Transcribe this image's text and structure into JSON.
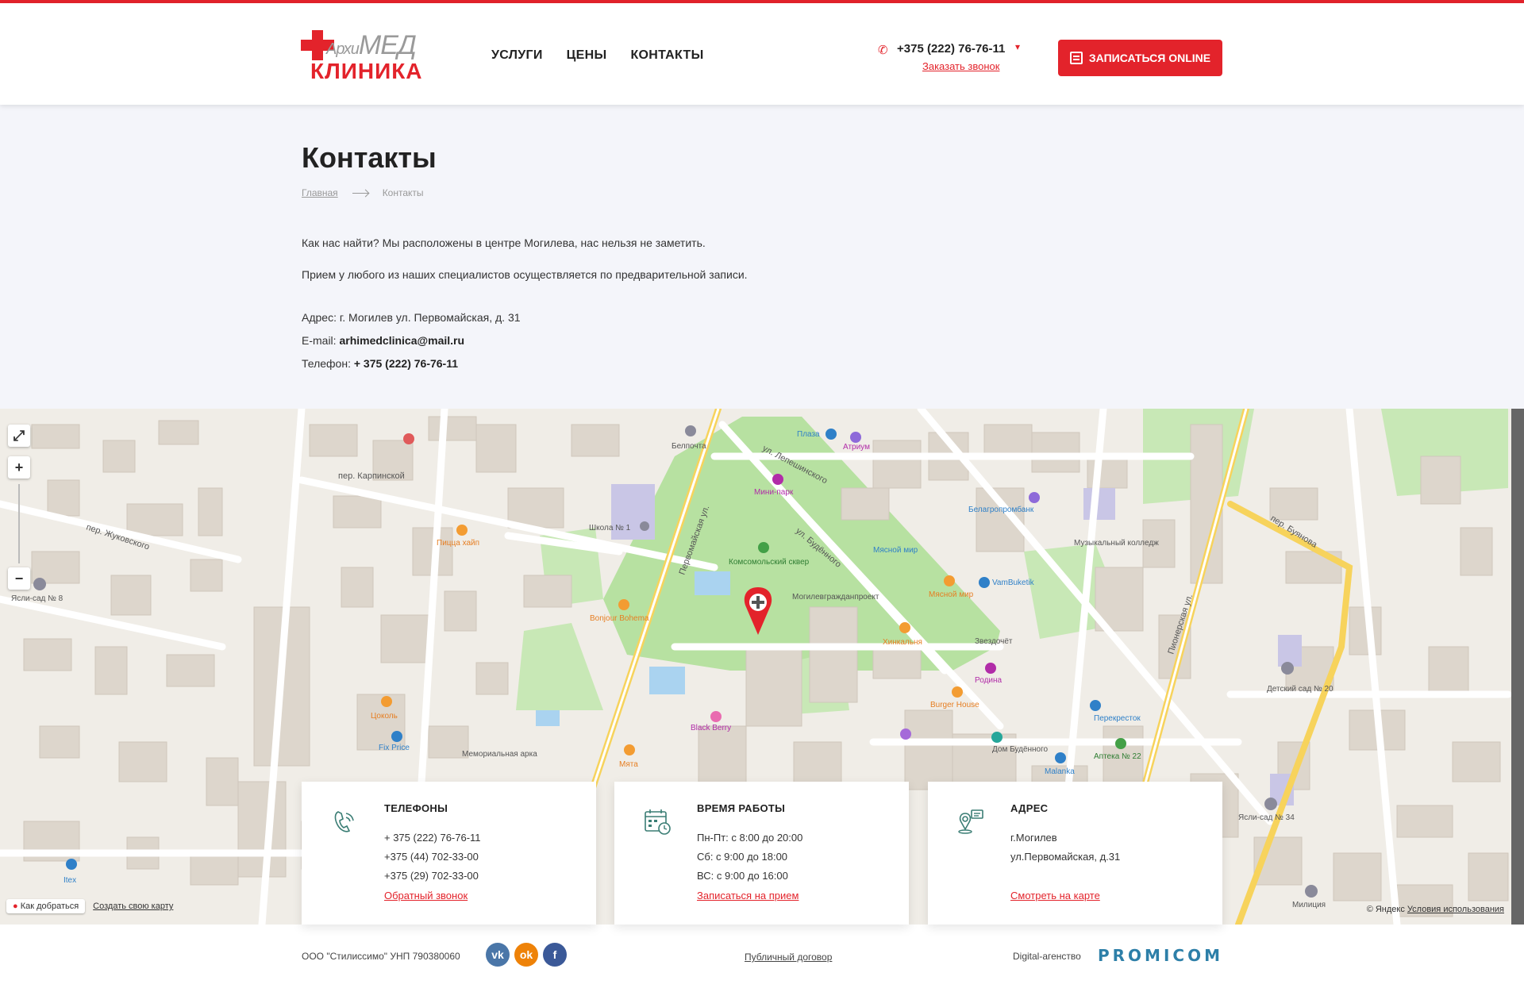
{
  "brand": {
    "logo_top_small": "Архи",
    "logo_top": "МЕД",
    "logo_bottom": "КЛИНИКА",
    "accent": "#e3232b"
  },
  "nav": {
    "items": [
      "УСЛУГИ",
      "ЦЕНЫ",
      "КОНТАКТЫ"
    ]
  },
  "header": {
    "phone": "+375 (222) 76-76-11",
    "callback": "Заказать звонок",
    "cta": "ЗАПИСАТЬСЯ ONLINE",
    "phone_icon": "phone-icon",
    "cta_icon": "form-icon"
  },
  "page": {
    "title": "Контакты",
    "breadcrumb_home": "Главная",
    "breadcrumb_current": "Контакты",
    "intro1": "Как нас найти? Мы расположены в центре Могилева, нас нельзя не заметить.",
    "intro2": "Прием у любого из наших специалистов осуществляется по предварительной записи.",
    "address_label": "Адрес:",
    "address": "г. Могилев ул. Первомайская, д. 31",
    "email_label": "E-mail:",
    "email": "arhimedclinica@mail.ru",
    "phone_label": "Телефон:",
    "phone": "+ 375 (222) 76-76-11"
  },
  "map": {
    "route": "Как добраться",
    "create": "Создать свою карту",
    "attribution": "© Яндекс",
    "terms": "Условия использования",
    "zoom_in": "+",
    "zoom_out": "−",
    "fullscreen_icon": "expand-icon",
    "labels": {
      "pervomayskaya": "Первомайская ул.",
      "pionerskaya": "Пионерская ул.",
      "lepeshinskogo": "ул. Лепешинского",
      "budennogo": "ул. Будённого",
      "karpinskoy": "пер. Карпинской",
      "zhukovskogo": "пер. Жуковского",
      "buyanova": "пер. Буянова",
      "komsomolsky": "Комсомольский сквер",
      "mini_park": "Мини-парк",
      "shkola": "Школа № 1",
      "plaza": "Плаза",
      "atrium": "Атриум",
      "myasnoy": "Мясной мир",
      "burger": "Burger House",
      "hinkalnya": "Хинкальня",
      "blackberry": "Black Berry",
      "bonjour": "Bonjour Bohema",
      "pizza": "Пицца хайп",
      "fixprice": "Fix Price",
      "tsokol": "Цоколь",
      "mogilev": "Могилевграждан­проект",
      "belagro": "Белагропромбанк",
      "muz": "Музыкальный колледж",
      "vambuketik": "VamBuketik",
      "zvezdochet": "Звездочёт",
      "rodina": "Родина",
      "perekrestok": "Перекресток",
      "apteka": "Аптека № 22",
      "malanka": "Malanka",
      "dom": "Дом Будённого",
      "memorial": "Мемориальная арка",
      "myata": "Мята",
      "yasli8": "Ясли-сад № 8",
      "detsad20": "Детский сад № 20",
      "yasli34": "Ясли-сад № 34",
      "militsiya": "Милиция",
      "itex": "Itex",
      "belpochta": "Белпочта"
    }
  },
  "cards": [
    {
      "title": "ТЕЛЕФОНЫ",
      "icon": "phone-outline-icon",
      "lines": [
        "+ 375 (222) 76-76-11",
        "+375 (44) 702-33-00",
        "+375 (29) 702-33-00"
      ],
      "link": "Обратный звонок"
    },
    {
      "title": "ВРЕМЯ РАБОТЫ",
      "icon": "calendar-clock-icon",
      "lines": [
        "Пн-Пт: с 8:00 до 20:00",
        "Сб: с 9:00 до 18:00",
        "ВС: с 9:00 до 16:00"
      ],
      "link": "Записаться на прием"
    },
    {
      "title": "АДРЕС",
      "icon": "location-pin-icon",
      "lines": [
        "г.Могилев",
        "ул.Первомайская, д.31"
      ],
      "link": "Смотреть на карте"
    }
  ],
  "footer": {
    "company": "ООО \"Стилиссимо\" УНП 790380060",
    "contract": "Публичный договор",
    "agency_label": "Digital-агенство",
    "agency": "PROMICOM",
    "social": [
      {
        "name": "vk-icon",
        "glyph": "vk",
        "color": "#4a76a8"
      },
      {
        "name": "odnoklassniki-icon",
        "glyph": "ok",
        "color": "#ee8208"
      },
      {
        "name": "facebook-icon",
        "glyph": "f",
        "color": "#3b5998"
      }
    ]
  }
}
